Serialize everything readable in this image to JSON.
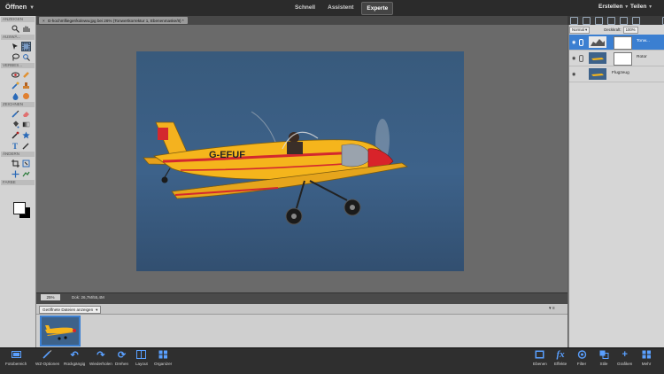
{
  "topbar": {
    "open_label": "Öffnen",
    "modes": [
      "Schnell",
      "Assistent",
      "Experte"
    ],
    "active_mode": "Experte",
    "create_label": "Erstellen",
    "share_label": "Teilen"
  },
  "toolbar": {
    "sections": [
      "ANZEIGEN",
      "AUSWÄ...",
      "VERBES...",
      "ZEICHNEN",
      "ÄNDERN",
      "FARBE"
    ]
  },
  "document": {
    "tab_title": "G-hochmflieger/koleww.jpg bei 26% (Tonwertkorrektur 1, Ebenenmaske/8) *",
    "close_glyph": "×",
    "plane_registration": "G-EFUF"
  },
  "status": {
    "zoom": "25%",
    "doc_size": "Dok: 26,7M/55,4M"
  },
  "photo_bin": {
    "select_label": "Geöffnete Dateien anzeigen",
    "controls": "▾ ≡"
  },
  "layers": {
    "blend_mode": "Normal",
    "opacity_label": "Deckkraft:",
    "opacity_value": "100%",
    "rows": [
      {
        "name": "Tonw...",
        "selected": true,
        "has_mask": true
      },
      {
        "name": "Rotor",
        "selected": false,
        "has_mask": true
      },
      {
        "name": "Flugzeug",
        "selected": false,
        "has_mask": false
      }
    ]
  },
  "bottombar": {
    "left_items": [
      "Fotobereich",
      "WZ-Optionen",
      "Rückgängig",
      "Wiederholen",
      "Drehen",
      "Layout",
      "Organizer"
    ],
    "right_items": [
      "Ebenen",
      "Effekte",
      "Filter",
      "Stile",
      "Grafiken",
      "Mehr"
    ],
    "icons": {
      "Fotobereich": "photo-bin-icon",
      "WZ-Optionen": "tool-options-icon",
      "Rückgängig": "undo-icon",
      "Wiederholen": "redo-icon",
      "Drehen": "rotate-icon",
      "Layout": "layout-icon",
      "Organizer": "organizer-icon",
      "Ebenen": "layers-icon",
      "Effekte": "fx-icon",
      "Filter": "filter-icon",
      "Stile": "styles-icon",
      "Grafiken": "graphics-icon",
      "Mehr": "more-icon"
    },
    "accent_color": "#5aa0ff"
  }
}
